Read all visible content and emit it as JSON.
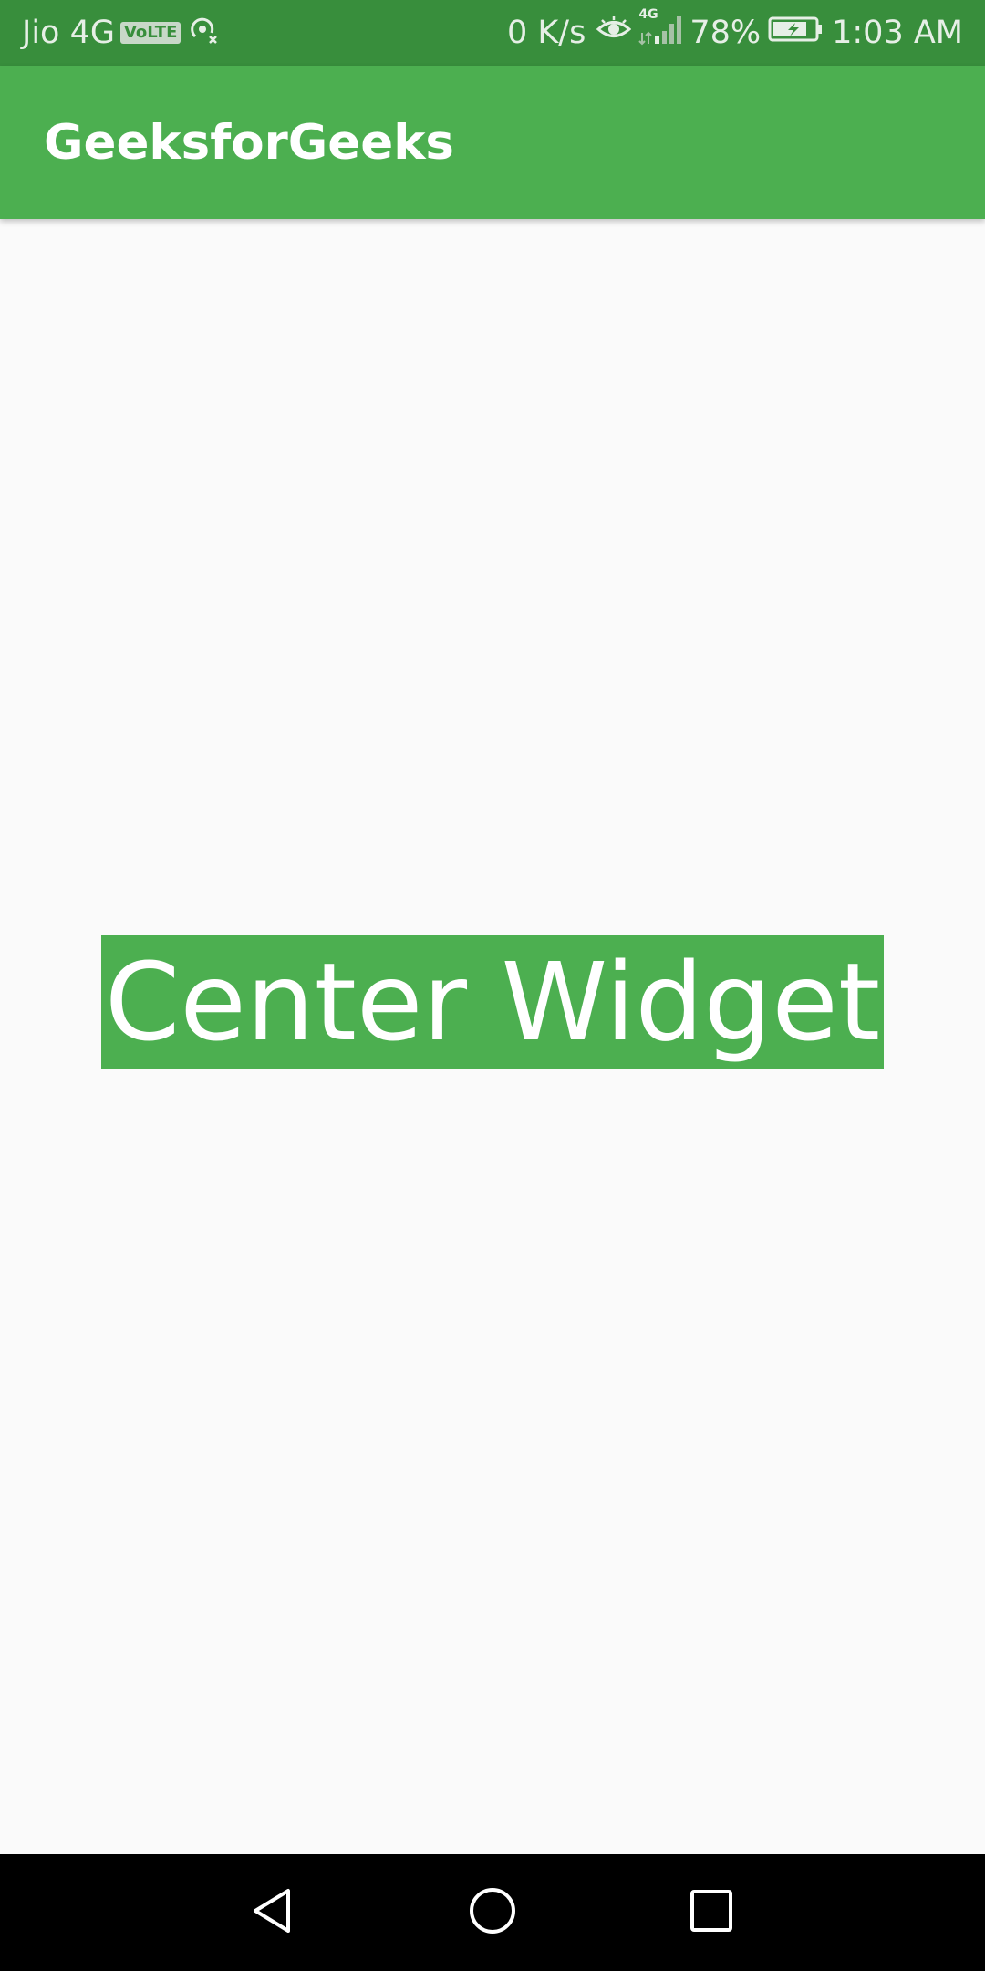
{
  "status_bar": {
    "carrier": "Jio 4G",
    "volte_badge": "VoLTE",
    "network_speed": "0 K/s",
    "signal_label": "4G",
    "battery_percent": "78%",
    "time": "1:03 AM",
    "icons": [
      "hotspot-icon",
      "eye-comfort-icon",
      "signal-icon",
      "battery-charging-icon"
    ]
  },
  "app_bar": {
    "title": "GeeksforGeeks"
  },
  "main": {
    "center_text": "Center Widget"
  },
  "navigation": {
    "icons": [
      "back-icon",
      "home-icon",
      "recent-apps-icon"
    ]
  },
  "colors": {
    "status_bar": "#388e3c",
    "app_bar": "#4caf50",
    "widget_background": "#4caf50",
    "background": "#fafafa",
    "nav_bar": "#000000"
  }
}
